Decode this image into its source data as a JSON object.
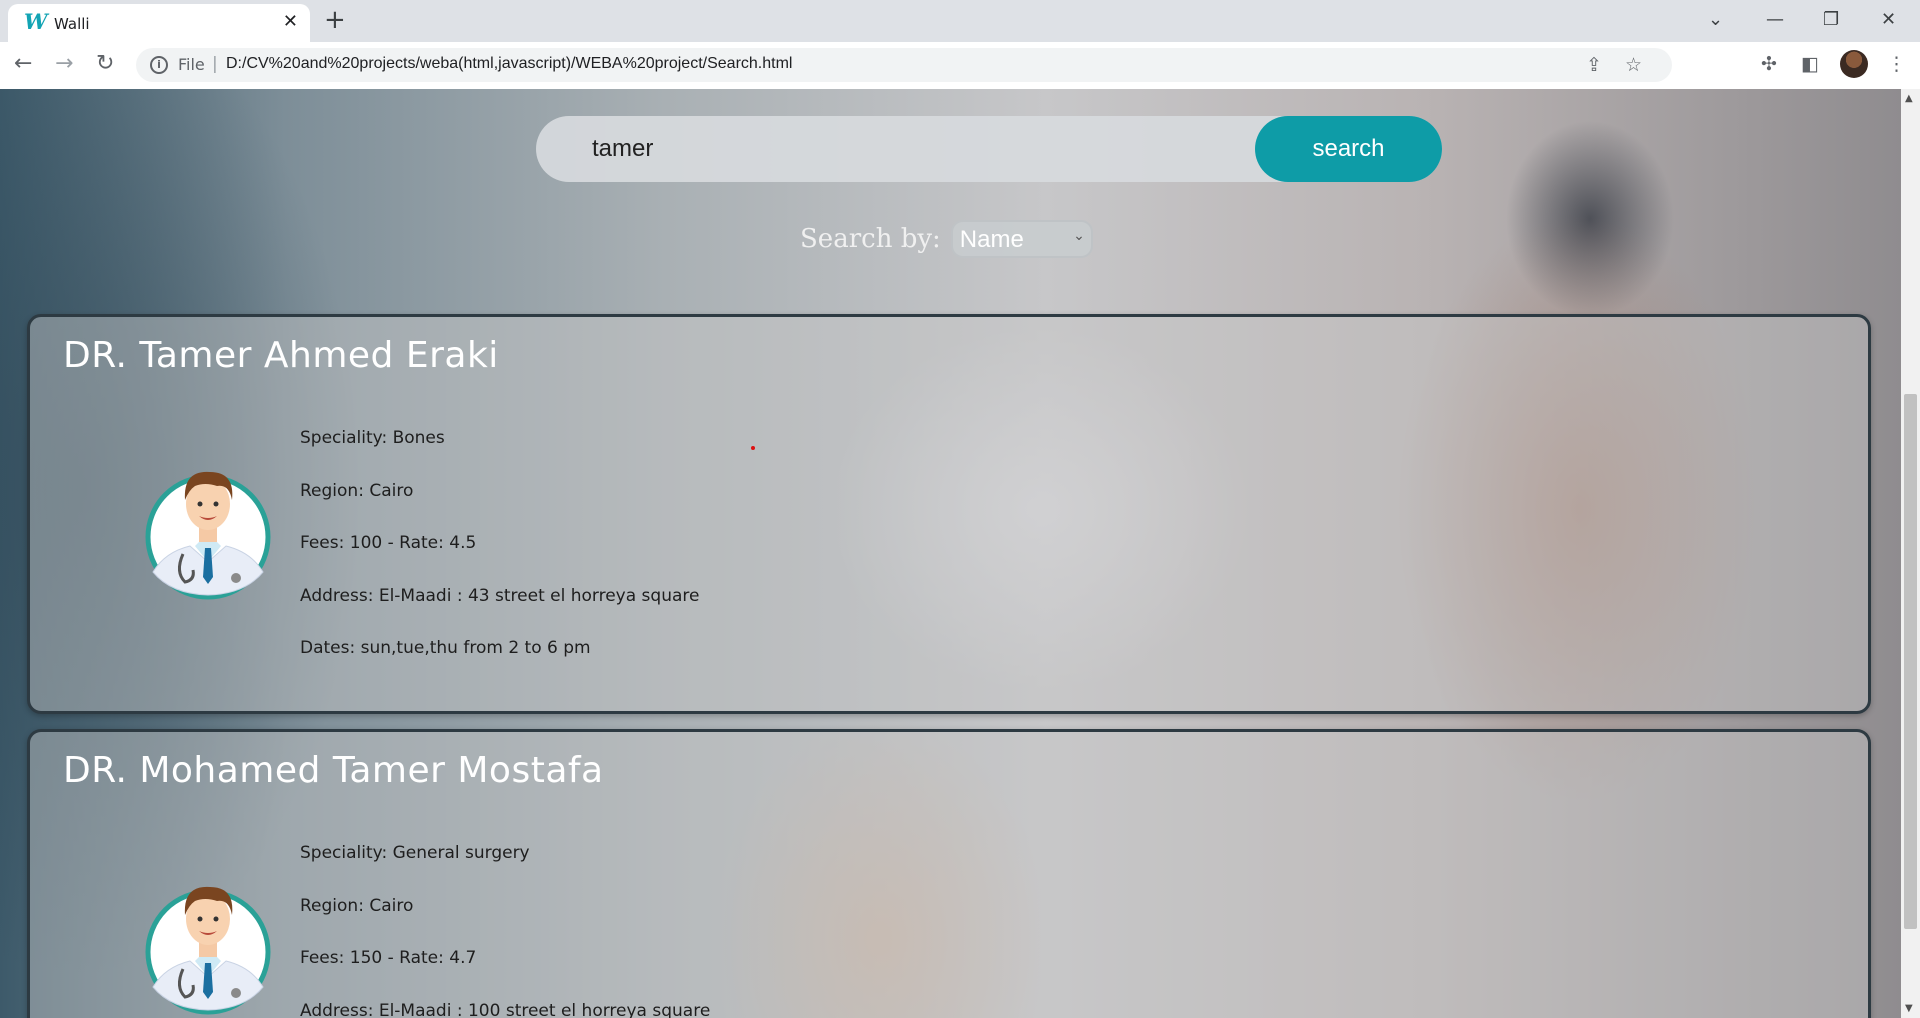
{
  "browser": {
    "tab_title": "Walli",
    "tab_favicon": "W",
    "tab_close": "✕",
    "new_tab": "+",
    "url_scheme": "File",
    "url_separator": "|",
    "url": "D:/CV%20and%20projects/weba(html,javascript)/WEBA%20project/Search.html",
    "window_controls": {
      "dropdown": "⌄",
      "minimize": "—",
      "restore": "❐",
      "close": "✕"
    },
    "nav": {
      "back": "←",
      "forward": "→",
      "reload": "↻"
    },
    "icons": [
      "info-icon",
      "share-icon",
      "star-icon",
      "extensions-icon",
      "sidepanel-icon",
      "profile-avatar",
      "menu-icon"
    ]
  },
  "search": {
    "query": "tamer",
    "button_label": "search",
    "search_by_label": "Search by:",
    "search_by_value": "Name",
    "accent_color": "#0e9ca7"
  },
  "doctors": [
    {
      "name": "DR. Tamer Ahmed Eraki",
      "speciality": "Speciality: Bones",
      "region": "Region: Cairo",
      "fees_rate": "Fees: 100 - Rate: 4.5",
      "address": "Address: El-Maadi : 43 street el horreya square",
      "dates": "Dates: sun,tue,thu from 2 to 6 pm"
    },
    {
      "name": "DR. Mohamed Tamer Mostafa",
      "speciality": "Speciality: General surgery",
      "region": "Region: Cairo",
      "fees_rate": "Fees: 150 - Rate: 4.7",
      "address": "Address: El-Maadi : 100 street el horreya square"
    }
  ],
  "scroll": {
    "position_fraction": 0.33
  }
}
